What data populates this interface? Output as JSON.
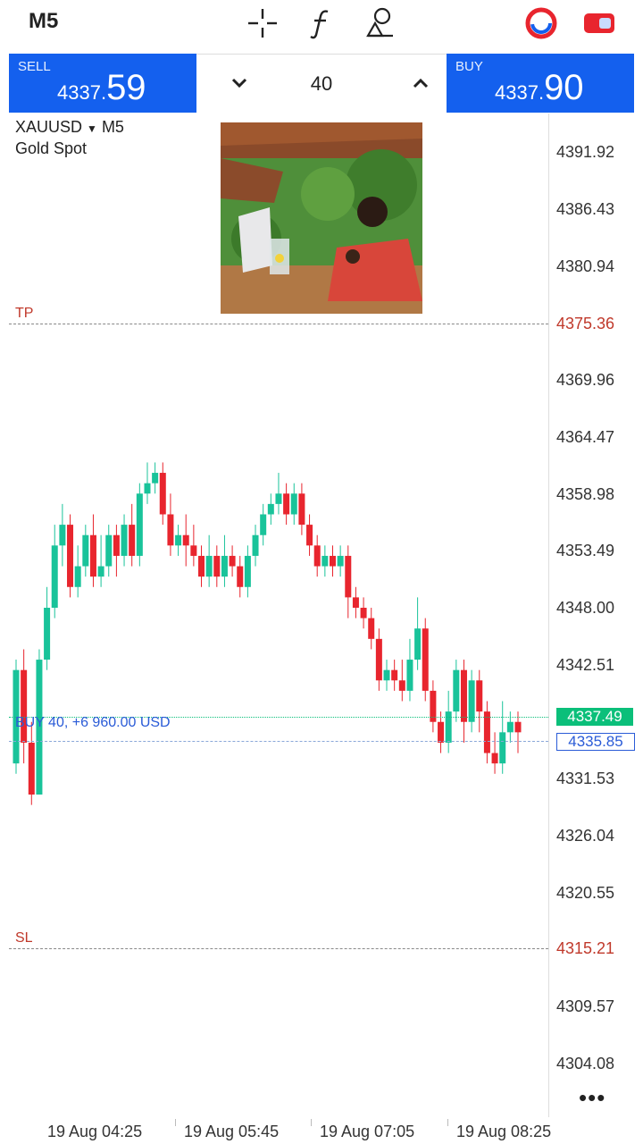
{
  "toolbar": {
    "timeframe": "M5",
    "icons": [
      "crosshair-icon",
      "function-icon",
      "objects-icon",
      "trade-session-icon",
      "toggle-icon"
    ]
  },
  "trade": {
    "sell_label": "SELL",
    "sell_price_main": "4337.",
    "sell_price_big": "59",
    "buy_label": "BUY",
    "buy_price_main": "4337.",
    "buy_price_big": "90",
    "lot": "40"
  },
  "symbol": {
    "name": "XAUUSD",
    "timeframe": "M5",
    "description": "Gold Spot"
  },
  "position_label": "BUY 40, +6 960.00 USD",
  "chart_data": {
    "type": "candlestick",
    "y_ticks": [
      "4391.92",
      "4386.43",
      "4380.94",
      "4375.36",
      "4369.96",
      "4364.47",
      "4358.98",
      "4353.49",
      "4348.00",
      "4342.51",
      "4337.49",
      "4335.85",
      "4331.53",
      "4326.04",
      "4320.55",
      "4315.21",
      "4309.57",
      "4304.08"
    ],
    "x_ticks": [
      "19 Aug 04:25",
      "19 Aug 05:45",
      "19 Aug 07:05",
      "19 Aug 08:25"
    ],
    "ylim": [
      4302,
      4395
    ],
    "levels": {
      "tp": {
        "label": "TP",
        "value": 4375.36,
        "color": "#c0392b"
      },
      "sl": {
        "label": "SL",
        "value": 4315.21,
        "color": "#c0392b"
      },
      "bid": {
        "value": 4337.49,
        "color": "#0bbf7a"
      },
      "entry": {
        "value": 4335.85,
        "color": "#2a5bd7"
      }
    },
    "colors": {
      "up": "#19c39a",
      "down": "#e8252e"
    },
    "candles": [
      [
        4333,
        4342,
        4332,
        4343
      ],
      [
        4342,
        4335,
        4333,
        4344
      ],
      [
        4335,
        4330,
        4329,
        4337
      ],
      [
        4330,
        4343,
        4330,
        4344
      ],
      [
        4343,
        4348,
        4342,
        4350
      ],
      [
        4348,
        4354,
        4347,
        4356
      ],
      [
        4354,
        4356,
        4352,
        4358
      ],
      [
        4356,
        4350,
        4349,
        4357
      ],
      [
        4350,
        4352,
        4349,
        4354
      ],
      [
        4352,
        4355,
        4351,
        4356
      ],
      [
        4355,
        4351,
        4350,
        4357
      ],
      [
        4351,
        4352,
        4350,
        4355
      ],
      [
        4352,
        4355,
        4351,
        4356
      ],
      [
        4355,
        4353,
        4351,
        4356
      ],
      [
        4353,
        4356,
        4352,
        4357
      ],
      [
        4356,
        4353,
        4352,
        4358
      ],
      [
        4353,
        4359,
        4352,
        4360
      ],
      [
        4359,
        4360,
        4358,
        4362
      ],
      [
        4360,
        4361,
        4359,
        4362
      ],
      [
        4361,
        4357,
        4356,
        4362
      ],
      [
        4357,
        4354,
        4353,
        4359
      ],
      [
        4354,
        4355,
        4353,
        4356
      ],
      [
        4355,
        4354,
        4352,
        4357
      ],
      [
        4354,
        4353,
        4352,
        4356
      ],
      [
        4353,
        4351,
        4350,
        4354
      ],
      [
        4351,
        4353,
        4350,
        4355
      ],
      [
        4353,
        4351,
        4350,
        4354
      ],
      [
        4351,
        4353,
        4350,
        4355
      ],
      [
        4353,
        4352,
        4351,
        4354
      ],
      [
        4352,
        4350,
        4349,
        4353
      ],
      [
        4350,
        4353,
        4349,
        4354
      ],
      [
        4353,
        4355,
        4352,
        4356
      ],
      [
        4355,
        4357,
        4354,
        4358
      ],
      [
        4357,
        4358,
        4356,
        4359
      ],
      [
        4358,
        4359,
        4357,
        4361
      ],
      [
        4359,
        4357,
        4356,
        4360
      ],
      [
        4357,
        4359,
        4356,
        4360
      ],
      [
        4359,
        4356,
        4355,
        4360
      ],
      [
        4356,
        4354,
        4353,
        4357
      ],
      [
        4354,
        4352,
        4351,
        4355
      ],
      [
        4352,
        4353,
        4351,
        4354
      ],
      [
        4353,
        4352,
        4351,
        4354
      ],
      [
        4352,
        4353,
        4351,
        4354
      ],
      [
        4353,
        4349,
        4347,
        4354
      ],
      [
        4349,
        4348,
        4347,
        4350
      ],
      [
        4348,
        4347,
        4346,
        4349
      ],
      [
        4347,
        4345,
        4344,
        4348
      ],
      [
        4345,
        4341,
        4340,
        4346
      ],
      [
        4341,
        4342,
        4340,
        4343
      ],
      [
        4342,
        4341,
        4340,
        4343
      ],
      [
        4341,
        4340,
        4339,
        4343
      ],
      [
        4340,
        4343,
        4339,
        4345
      ],
      [
        4343,
        4346,
        4342,
        4349
      ],
      [
        4346,
        4340,
        4339,
        4347
      ],
      [
        4340,
        4337,
        4336,
        4341
      ],
      [
        4337,
        4335,
        4334,
        4338
      ],
      [
        4335,
        4338,
        4334,
        4340
      ],
      [
        4338,
        4342,
        4337,
        4343
      ],
      [
        4342,
        4337,
        4335,
        4343
      ],
      [
        4337,
        4341,
        4336,
        4342
      ],
      [
        4341,
        4338,
        4336,
        4342
      ],
      [
        4338,
        4334,
        4333,
        4339
      ],
      [
        4334,
        4333,
        4332,
        4336
      ],
      [
        4333,
        4336,
        4332,
        4339
      ],
      [
        4336,
        4337,
        4335,
        4338
      ],
      [
        4337,
        4336,
        4334,
        4338
      ]
    ]
  }
}
